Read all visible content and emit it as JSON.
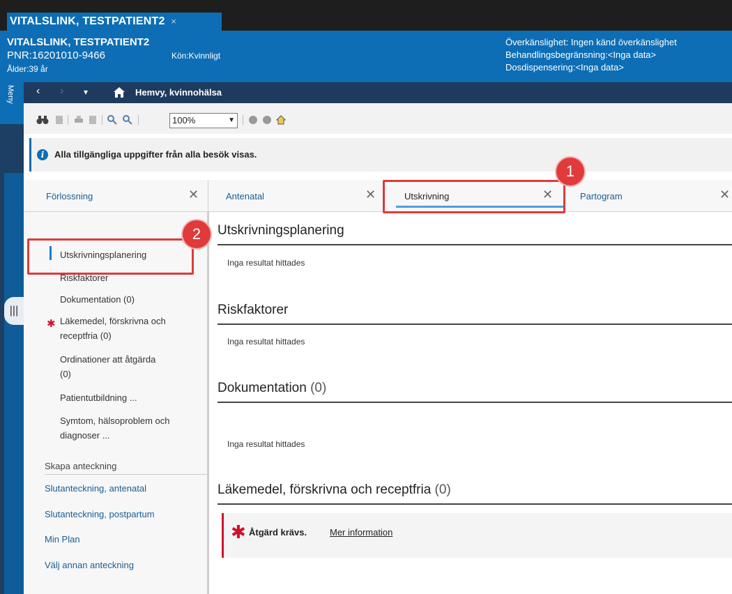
{
  "window_tab": {
    "title": "VITALSLINK, TESTPATIENT2",
    "close": "×"
  },
  "patient": {
    "name": "VITALSLINK, TESTPATIENT2",
    "pnr": "PNR:16201010-9466",
    "kon": "Kön:Kvinnligt",
    "alder": "Ålder:39 år",
    "overkanslighet": "Överkänslighet: Ingen känd överkänslighet",
    "behandlingsbegransning": "Behandlingsbegränsning:<Inga data>",
    "dosdispensering": "Dosdispensering:<Inga data>"
  },
  "meny": {
    "label": "Meny"
  },
  "nav": {
    "back": "‹",
    "forward": "›",
    "dropdown": "▾",
    "title": "Hemvy, kvinnohälsa"
  },
  "toolbar": {
    "zoom_value": "100%"
  },
  "info": {
    "text": "Alla tillgängliga uppgifter från alla besök visas."
  },
  "tabs": [
    {
      "label": "Förlossning",
      "close": "✕"
    },
    {
      "label": "Antenatal",
      "close": "✕"
    },
    {
      "label": "Utskrivning",
      "close": "✕"
    },
    {
      "label": "Partogram",
      "close": "✕"
    }
  ],
  "sidebar": {
    "items": [
      "Utskrivningsplanering",
      "Riskfaktorer",
      "Dokumentation (0)",
      "Läkemedel, förskrivna och",
      "receptfria (0)",
      "Ordinationer att åtgärda",
      "(0)",
      "Patientutbildning ...",
      "Symtom, hälsoproblem och",
      "diagnoser ..."
    ],
    "create_heading": "Skapa anteckning",
    "create_links": [
      "Slutanteckning, antenatal",
      "Slutanteckning, postpartum",
      "Min Plan",
      "Välj annan anteckning"
    ]
  },
  "main": {
    "sections": [
      {
        "title": "Utskrivningsplanering",
        "count": "",
        "empty": "Inga resultat hittades"
      },
      {
        "title": "Riskfaktorer",
        "count": "",
        "empty": "Inga resultat hittades"
      },
      {
        "title": "Dokumentation",
        "count": "(0)",
        "empty": "Inga resultat hittades"
      },
      {
        "title": "Läkemedel, förskrivna och receptfria",
        "count": "(0)",
        "empty": ""
      }
    ],
    "alert": {
      "star": "✱",
      "message": "Åtgärd krävs.",
      "link": "Mer information"
    }
  },
  "callouts": {
    "one": "1",
    "two": "2"
  },
  "colors": {
    "banner": "#0d6eb5",
    "callout": "#e03a3a",
    "required": "#d0122b"
  }
}
